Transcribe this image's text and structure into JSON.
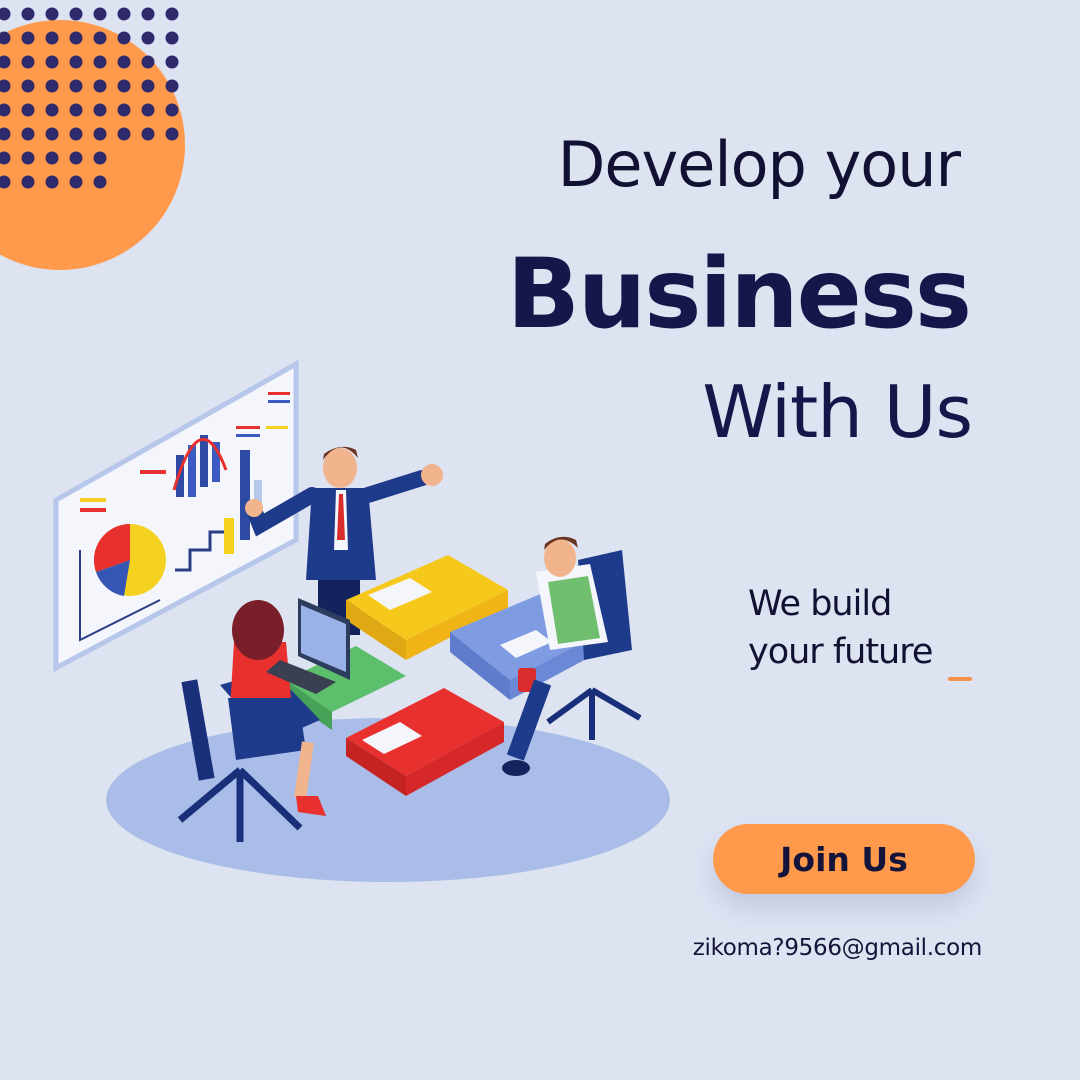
{
  "headline": {
    "line1": "Develop your",
    "line2": "Business",
    "line3": "With Us"
  },
  "tagline": {
    "line1": "We build",
    "line2": "your future"
  },
  "cta": {
    "label": "Join Us"
  },
  "contact": {
    "email": "zikoma?9566@gmail.com"
  },
  "colors": {
    "background": "#dde3f1",
    "accent_orange": "#ff9a4d",
    "dots_navy": "#2e2a6b",
    "text_navy": "#16164a"
  },
  "icons": {
    "corner": "dot-grid-circle-decoration",
    "illustration": "business-team-puzzle-meeting"
  }
}
